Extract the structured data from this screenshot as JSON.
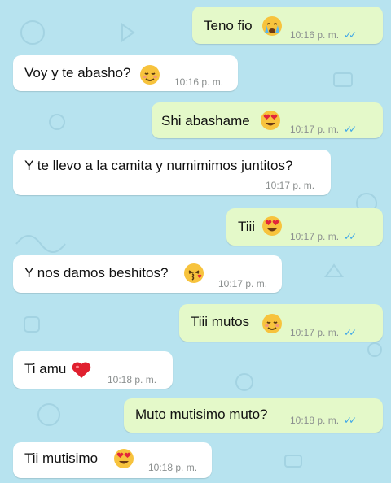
{
  "chat": {
    "colors": {
      "background": "#b7e3ef",
      "incoming": "#ffffff",
      "outgoing": "#e4f9c9",
      "read_ticks": "#3fa7e8"
    },
    "messages": [
      {
        "direction": "out",
        "text": "Teno fio",
        "emoji": "crying-face",
        "time": "10:16 p. m.",
        "status": "read",
        "ticks": "✓✓"
      },
      {
        "direction": "in",
        "text": "Voy y te abasho?",
        "emoji": "smiling-blushing-face",
        "time": "10:16 p. m."
      },
      {
        "direction": "out",
        "text": "Shi abashame",
        "emoji": "heart-eyes-face",
        "time": "10:17 p. m.",
        "status": "read",
        "ticks": "✓✓"
      },
      {
        "direction": "in",
        "text": "Y te llevo a la camita y numimimos juntitos?",
        "time": "10:17 p. m."
      },
      {
        "direction": "out",
        "text": "Tiii",
        "emoji": "heart-eyes-face",
        "time": "10:17 p. m.",
        "status": "read",
        "ticks": "✓✓"
      },
      {
        "direction": "in",
        "text": "Y nos damos beshitos?",
        "emoji": "kissing-heart-face",
        "time": "10:17 p. m."
      },
      {
        "direction": "out",
        "text": "Tiii mutos",
        "emoji": "smiling-blushing-face",
        "time": "10:17 p. m.",
        "status": "read",
        "ticks": "✓✓"
      },
      {
        "direction": "in",
        "text": "Ti amu",
        "emoji": "red-heart",
        "time": "10:18 p. m."
      },
      {
        "direction": "out",
        "text": "Muto mutisimo muto?",
        "time": "10:18 p. m.",
        "status": "read",
        "ticks": "✓✓"
      },
      {
        "direction": "in",
        "text": "Tii mutisimo",
        "emoji": "heart-eyes-face",
        "time": "10:18 p. m."
      }
    ]
  }
}
